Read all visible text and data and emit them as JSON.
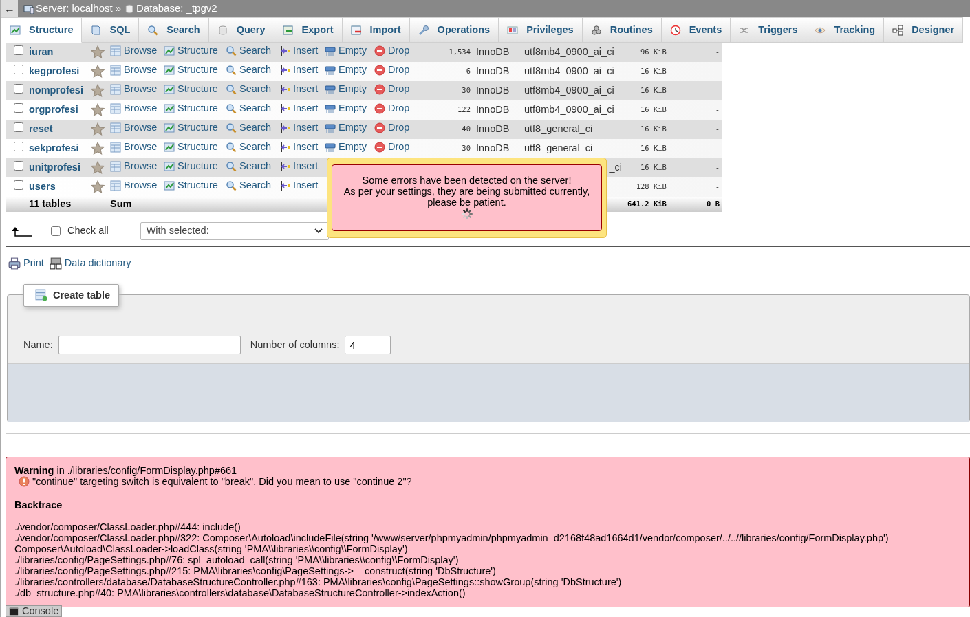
{
  "breadcrumb": {
    "back": "←",
    "server": "Server: localhost",
    "separator": "»",
    "database": "Database: _tpgv2"
  },
  "tabs": [
    {
      "label": "Structure",
      "selected": true
    },
    {
      "label": "SQL",
      "selected": false
    },
    {
      "label": "Search",
      "selected": false
    },
    {
      "label": "Query",
      "selected": false
    },
    {
      "label": "Export",
      "selected": false
    },
    {
      "label": "Import",
      "selected": false
    },
    {
      "label": "Operations",
      "selected": false
    },
    {
      "label": "Privileges",
      "selected": false
    },
    {
      "label": "Routines",
      "selected": false
    },
    {
      "label": "Events",
      "selected": false
    },
    {
      "label": "Triggers",
      "selected": false
    },
    {
      "label": "Tracking",
      "selected": false
    },
    {
      "label": "Designer",
      "selected": false
    }
  ],
  "tables": {
    "rows": [
      {
        "name": "iuran",
        "checked": false,
        "actions": [
          {
            "kind": "browse",
            "label": "Browse"
          },
          {
            "kind": "structure",
            "label": "Structure"
          },
          {
            "kind": "search",
            "label": "Search"
          },
          {
            "kind": "insert",
            "label": "Insert"
          },
          {
            "kind": "empty",
            "label": "Empty"
          },
          {
            "kind": "drop",
            "label": "Drop"
          }
        ],
        "records": "1,534",
        "engine": "InnoDB",
        "collation": "utf8mb4_0900_ai_ci",
        "size": "96 KiB",
        "overhead": "-"
      },
      {
        "name": "kegprofesi",
        "checked": false,
        "actions": [
          {
            "kind": "browse",
            "label": "Browse"
          },
          {
            "kind": "structure",
            "label": "Structure"
          },
          {
            "kind": "search",
            "label": "Search"
          },
          {
            "kind": "insert",
            "label": "Insert"
          },
          {
            "kind": "empty",
            "label": "Empty"
          },
          {
            "kind": "drop",
            "label": "Drop"
          }
        ],
        "records": "6",
        "engine": "InnoDB",
        "collation": "utf8mb4_0900_ai_ci",
        "size": "16 KiB",
        "overhead": "-"
      },
      {
        "name": "nomprofesi",
        "checked": false,
        "actions": [
          {
            "kind": "browse",
            "label": "Browse"
          },
          {
            "kind": "structure",
            "label": "Structure"
          },
          {
            "kind": "search",
            "label": "Search"
          },
          {
            "kind": "insert",
            "label": "Insert"
          },
          {
            "kind": "empty",
            "label": "Empty"
          },
          {
            "kind": "drop",
            "label": "Drop"
          }
        ],
        "records": "30",
        "engine": "InnoDB",
        "collation": "utf8mb4_0900_ai_ci",
        "size": "16 KiB",
        "overhead": "-"
      },
      {
        "name": "orgprofesi",
        "checked": false,
        "actions": [
          {
            "kind": "browse",
            "label": "Browse"
          },
          {
            "kind": "structure",
            "label": "Structure"
          },
          {
            "kind": "search",
            "label": "Search"
          },
          {
            "kind": "insert",
            "label": "Insert"
          },
          {
            "kind": "empty",
            "label": "Empty"
          },
          {
            "kind": "drop",
            "label": "Drop"
          }
        ],
        "records": "122",
        "engine": "InnoDB",
        "collation": "utf8mb4_0900_ai_ci",
        "size": "16 KiB",
        "overhead": "-"
      },
      {
        "name": "reset",
        "checked": false,
        "actions": [
          {
            "kind": "browse",
            "label": "Browse"
          },
          {
            "kind": "structure",
            "label": "Structure"
          },
          {
            "kind": "search",
            "label": "Search"
          },
          {
            "kind": "insert",
            "label": "Insert"
          },
          {
            "kind": "empty",
            "label": "Empty"
          },
          {
            "kind": "drop",
            "label": "Drop"
          }
        ],
        "records": "40",
        "engine": "InnoDB",
        "collation": "utf8_general_ci",
        "size": "16 KiB",
        "overhead": "-"
      },
      {
        "name": "sekprofesi",
        "checked": false,
        "actions": [
          {
            "kind": "browse",
            "label": "Browse"
          },
          {
            "kind": "structure",
            "label": "Structure"
          },
          {
            "kind": "search",
            "label": "Search"
          },
          {
            "kind": "insert",
            "label": "Insert"
          },
          {
            "kind": "empty",
            "label": "Empty"
          },
          {
            "kind": "drop",
            "label": "Drop"
          }
        ],
        "records": "30",
        "engine": "InnoDB",
        "collation": "utf8_general_ci",
        "size": "16 KiB",
        "overhead": "-"
      },
      {
        "name": "unitprofesi",
        "checked": false,
        "actions": [
          {
            "kind": "browse",
            "label": "Browse"
          },
          {
            "kind": "structure",
            "label": "Structure"
          },
          {
            "kind": "search",
            "label": "Search"
          },
          {
            "kind": "insert",
            "label": "Insert"
          }
        ],
        "collation": "_ci",
        "collation_clipped": true,
        "size": "16 KiB",
        "overhead": "-"
      },
      {
        "name": "users",
        "checked": false,
        "actions": [
          {
            "kind": "browse",
            "label": "Browse"
          },
          {
            "kind": "structure",
            "label": "Structure"
          },
          {
            "kind": "search",
            "label": "Search"
          },
          {
            "kind": "insert",
            "label": "Insert"
          }
        ],
        "size": "128 KiB",
        "overhead": "-"
      }
    ],
    "summary": {
      "count": "11 tables",
      "label": "Sum",
      "size": "641.2 KiB",
      "overhead": "0 B"
    }
  },
  "bulk": {
    "check_all": {
      "label": "Check all",
      "checked": false
    },
    "with_selected": "With selected:"
  },
  "links": [
    {
      "kind": "print",
      "label": "Print"
    },
    {
      "kind": "dictionary",
      "label": "Data dictionary"
    }
  ],
  "create_table": {
    "legend": "Create table",
    "name_label": "Name:",
    "columns_label": "Number of columns:",
    "columns_value": "4"
  },
  "error_popup": {
    "lines": [
      "Some errors have been detected on the server!",
      "As per your settings, they are being submitted currently,",
      "please be patient."
    ]
  },
  "warning": {
    "heading": "**Warning** in ./libraries/config/FormDisplay.php#661",
    "message": "\"continue\" targeting switch is equivalent to \"break\". Did you mean to use \"continue 2\"?",
    "backtrace_title": "Backtrace",
    "backtrace": [
      "./vendor/composer/ClassLoader.php#444: include()",
      "./vendor/composer/ClassLoader.php#322: Composer\\Autoload\\includeFile(string '/www/server/phpmyadmin/phpmyadmin_d2168f48ad1664d1/vendor/composer/../..//libraries/config/FormDisplay.php')",
      "Composer\\Autoload\\ClassLoader->loadClass(string 'PMA\\\\libraries\\\\config\\\\FormDisplay')",
      "./libraries/config/PageSettings.php#76: spl_autoload_call(string 'PMA\\\\libraries\\\\config\\\\FormDisplay')",
      "./libraries/config/PageSettings.php#215: PMA\\libraries\\config\\PageSettings->__construct(string 'DbStructure')",
      "./libraries/controllers/database/DatabaseStructureController.php#163: PMA\\libraries\\config\\PageSettings::showGroup(string 'DbStructure')",
      "./db_structure.php#40: PMA\\libraries\\controllers\\database\\DatabaseStructureController->indexAction()"
    ]
  },
  "console": "Console"
}
